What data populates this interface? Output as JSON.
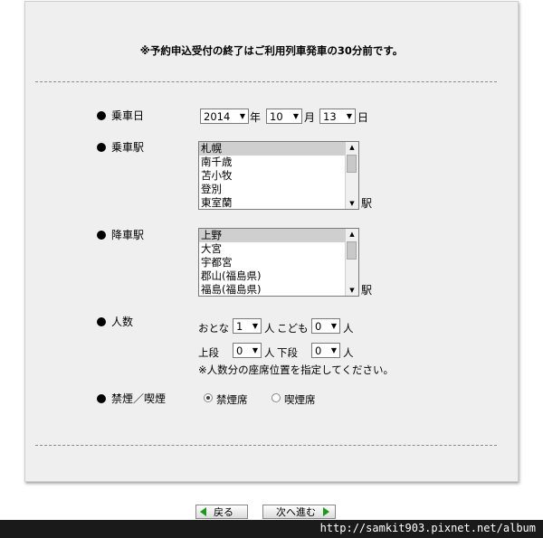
{
  "notice": "※予約申込受付の終了はご利用列車発車の30分前です。",
  "date": {
    "label": "乗車日",
    "year": "2014",
    "year_unit": "年",
    "month": "10",
    "month_unit": "月",
    "day": "13",
    "day_unit": "日"
  },
  "board": {
    "label": "乗車駅",
    "stations": [
      "札幌",
      "南千歳",
      "苫小牧",
      "登別",
      "東室蘭"
    ],
    "selected": "札幌",
    "suffix": "駅"
  },
  "alight": {
    "label": "降車駅",
    "stations": [
      "上野",
      "大宮",
      "宇都宮",
      "郡山(福島県)",
      "福島(福島県)"
    ],
    "selected": "上野",
    "suffix": "駅"
  },
  "people": {
    "label": "人数",
    "adult_label": "おとな",
    "adult": "1",
    "adult_unit": "人",
    "child_label": "こども",
    "child": "0",
    "child_unit": "人",
    "upper_label": "上段",
    "upper": "0",
    "upper_unit": "人",
    "lower_label": "下段",
    "lower": "0",
    "lower_unit": "人",
    "note": "※人数分の座席位置を指定してください。"
  },
  "smoking": {
    "label": "禁煙／喫煙",
    "option_nonsmoking": "禁煙席",
    "option_smoking": "喫煙席",
    "selected": "禁煙席"
  },
  "buttons": {
    "back": "戻る",
    "next": "次へ進む"
  },
  "watermark": "http://samkit903.pixnet.net/album"
}
